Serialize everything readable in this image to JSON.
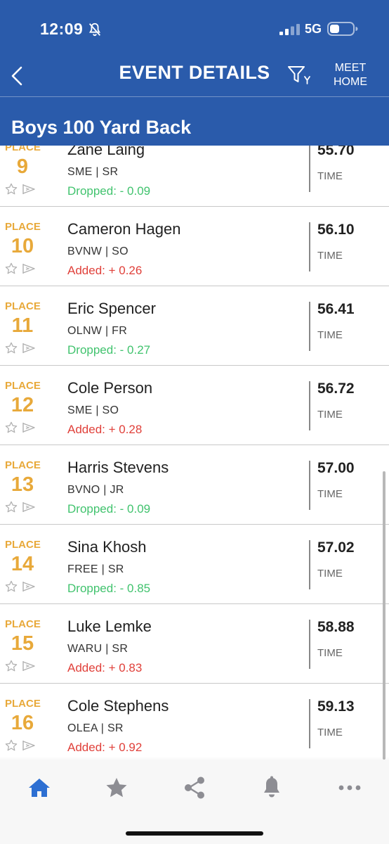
{
  "status_bar": {
    "time": "12:09",
    "network": "5G",
    "icons": [
      "bell-slash-icon",
      "signal-icon",
      "battery-icon"
    ]
  },
  "header": {
    "title": "EVENT DETAILS",
    "meet_home_line1": "MEET",
    "meet_home_line2": "HOME",
    "event_name": "Boys 100 Yard Back",
    "icons": [
      "back-chevron-icon",
      "filter-icon"
    ]
  },
  "labels": {
    "place": "PLACE",
    "time": "TIME"
  },
  "results": [
    {
      "place": "9",
      "name": "Zane Laing",
      "team": "SME | SR",
      "diff": "Dropped: - 0.09",
      "diff_type": "dropped",
      "time": "55.70"
    },
    {
      "place": "10",
      "name": "Cameron Hagen",
      "team": "BVNW | SO",
      "diff": "Added: + 0.26",
      "diff_type": "added",
      "time": "56.10"
    },
    {
      "place": "11",
      "name": "Eric Spencer",
      "team": "OLNW | FR",
      "diff": "Dropped: - 0.27",
      "diff_type": "dropped",
      "time": "56.41"
    },
    {
      "place": "12",
      "name": "Cole Person",
      "team": "SME | SO",
      "diff": "Added: + 0.28",
      "diff_type": "added",
      "time": "56.72"
    },
    {
      "place": "13",
      "name": "Harris Stevens",
      "team": "BVNO | JR",
      "diff": "Dropped: - 0.09",
      "diff_type": "dropped",
      "time": "57.00"
    },
    {
      "place": "14",
      "name": "Sina Khosh",
      "team": "FREE | SR",
      "diff": "Dropped: - 0.85",
      "diff_type": "dropped",
      "time": "57.02"
    },
    {
      "place": "15",
      "name": "Luke Lemke",
      "team": "WARU | SR",
      "diff": "Added: + 0.83",
      "diff_type": "added",
      "time": "58.88"
    },
    {
      "place": "16",
      "name": "Cole Stephens",
      "team": "OLEA | SR",
      "diff": "Added: + 0.92",
      "diff_type": "added",
      "time": "59.13"
    }
  ],
  "bottom_nav": [
    {
      "icon": "home-icon",
      "active": true
    },
    {
      "icon": "star-icon",
      "active": false
    },
    {
      "icon": "share-icon",
      "active": false
    },
    {
      "icon": "bell-icon",
      "active": false
    },
    {
      "icon": "more-icon",
      "active": false
    }
  ],
  "colors": {
    "header_bg": "#2a5bab",
    "place_accent": "#e8a93a",
    "dropped": "#41c36e",
    "added": "#e0403a",
    "nav_active": "#2d6fd2",
    "nav_inactive": "#8d8d93"
  }
}
